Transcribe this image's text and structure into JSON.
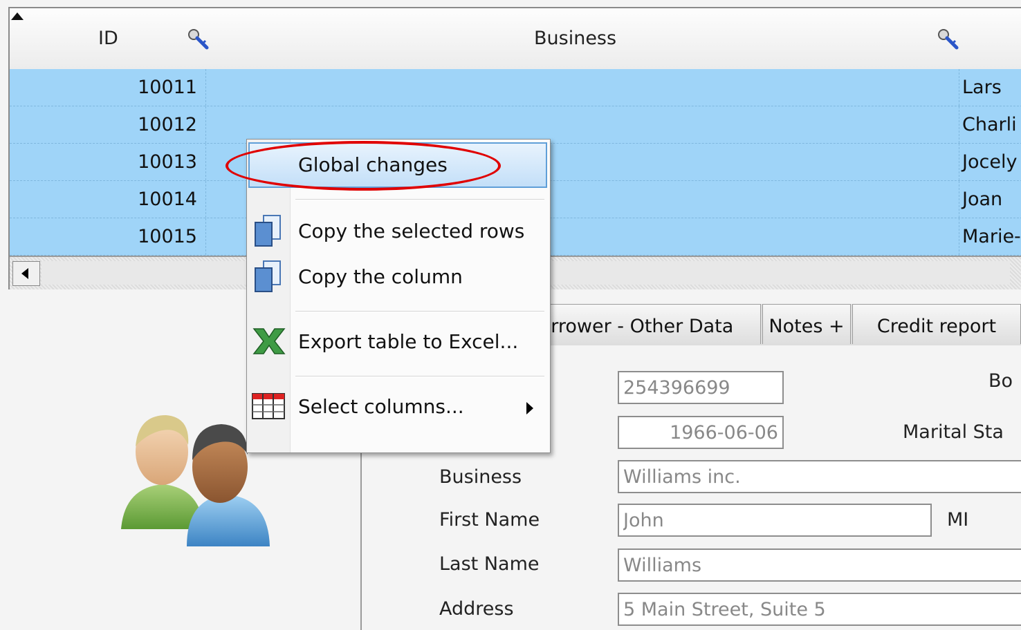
{
  "grid": {
    "columns": [
      {
        "label": "ID"
      },
      {
        "label": "Business"
      }
    ],
    "rows": [
      {
        "id": "10011",
        "name": "Lars"
      },
      {
        "id": "10012",
        "name": "Charli"
      },
      {
        "id": "10013",
        "name": "Jocely"
      },
      {
        "id": "10014",
        "name": "Joan"
      },
      {
        "id": "10015",
        "name": "Marie-"
      }
    ]
  },
  "tabs": [
    {
      "label": "orrower - Other Data"
    },
    {
      "label": "Notes +"
    },
    {
      "label": "Credit report"
    }
  ],
  "form": {
    "field_a_value": "254396699",
    "field_a_label_tail": ".",
    "label_bo": "Bo",
    "date_value": "1966-06-06",
    "marital_status_label": "Marital Sta",
    "business_label": "Business",
    "business_value": "Williams inc.",
    "first_name_label": "First Name",
    "first_name_value": "John",
    "mi_label": "MI",
    "last_name_label": "Last Name",
    "last_name_value": "Williams",
    "address_label": "Address",
    "address_value": "5 Main Street, Suite 5"
  },
  "context_menu": {
    "items": [
      {
        "label": "Global changes",
        "icon": "none"
      },
      {
        "label": "Copy the selected rows",
        "icon": "copy-icon"
      },
      {
        "label": "Copy the column",
        "icon": "copy-icon"
      },
      {
        "label": "Export table to Excel...",
        "icon": "excel-icon"
      },
      {
        "label": "Select columns...",
        "icon": "columns-icon"
      }
    ]
  },
  "colors": {
    "selection": "#9fd4f8",
    "annotation": "#e00000",
    "menu_highlight": "#c3dff8"
  }
}
